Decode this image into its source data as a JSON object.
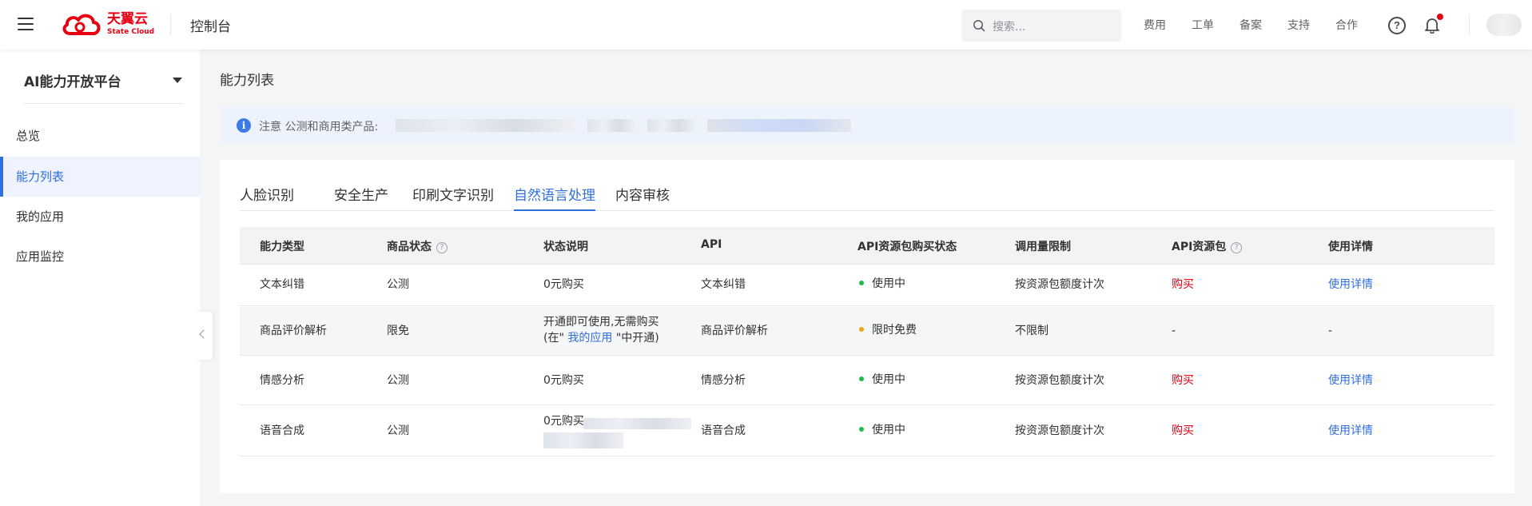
{
  "header": {
    "brand": {
      "name": "天翼云",
      "sub": "State Cloud"
    },
    "console_title": "控制台",
    "search": {
      "placeholder": "搜索..."
    },
    "nav": [
      "费用",
      "工单",
      "备案",
      "支持",
      "合作"
    ],
    "help_glyph": "?"
  },
  "sidebar": {
    "platform": "AI能力开放平台",
    "items": [
      {
        "label": "总览",
        "active": false
      },
      {
        "label": "能力列表",
        "active": true
      },
      {
        "label": "我的应用",
        "active": false
      },
      {
        "label": "应用监控",
        "active": false
      }
    ]
  },
  "main": {
    "title": "能力列表",
    "notice": {
      "icon": "i",
      "text": "注意 公测和商用类产品:"
    },
    "tabs": [
      "人脸识别",
      "安全生产",
      "印刷文字识别",
      "自然语言处理",
      "内容审核"
    ],
    "active_tab": 3,
    "table": {
      "headers": [
        "能力类型",
        "商品状态",
        "状态说明",
        "API",
        "API资源包购买状态",
        "调用量限制",
        "API资源包",
        "使用详情"
      ],
      "help_glyph": "?",
      "rows": [
        {
          "type": "文本纠错",
          "status": "公测",
          "desc_line1": "0元购买",
          "desc_line2": "",
          "desc_link": "",
          "desc_tail": "",
          "api": "文本纠错",
          "purchase_status": "使用中",
          "status_color": "#1fba4b",
          "limit": "按资源包额度计次",
          "package": "购买",
          "detail": "使用详情"
        },
        {
          "type": "商品评价解析",
          "status": "限免",
          "desc_line1": "开通即可使用,无需购买",
          "desc_line2": "(在\"",
          "desc_link": "我的应用",
          "desc_tail": "\"中开通)",
          "api": "商品评价解析",
          "purchase_status": "限时免费",
          "status_color": "#f0a31a",
          "limit": "不限制",
          "package": "-",
          "detail": "-"
        },
        {
          "type": "情感分析",
          "status": "公测",
          "desc_line1": "0元购买",
          "desc_line2": "",
          "desc_link": "",
          "desc_tail": "",
          "api": "情感分析",
          "purchase_status": "使用中",
          "status_color": "#1fba4b",
          "limit": "按资源包额度计次",
          "package": "购买",
          "detail": "使用详情"
        },
        {
          "type": "语音合成",
          "status": "公测",
          "desc_line1": "0元购买",
          "desc_line2": "",
          "desc_link": "",
          "desc_tail": "",
          "api": "语音合成",
          "purchase_status": "使用中",
          "status_color": "#1fba4b",
          "limit": "按资源包额度计次",
          "package": "购买",
          "detail": "使用详情"
        }
      ]
    }
  },
  "colors": {
    "accent": "#2f6fde",
    "brand_red": "#e60012",
    "active_green": "#1fba4b",
    "free_orange": "#f0a31a"
  },
  "icons": [
    "menu-icon",
    "cloud-logo-icon",
    "search-icon",
    "help-icon",
    "bell-icon",
    "info-icon",
    "question-icon",
    "chevron-left-icon"
  ]
}
